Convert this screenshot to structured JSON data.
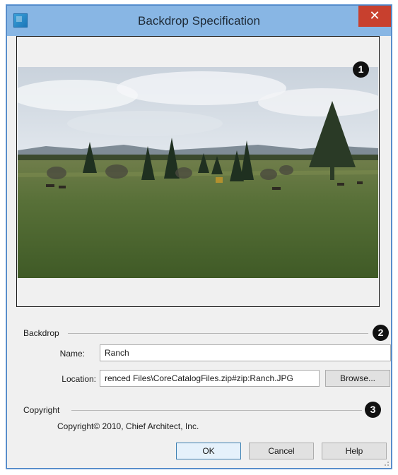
{
  "window": {
    "title": "Backdrop Specification",
    "close_glyph": "✕"
  },
  "icons": {
    "app": "app-icon",
    "close": "close-icon",
    "resize": "resize-grip-icon"
  },
  "callouts": [
    "1",
    "2",
    "3"
  ],
  "backdrop": {
    "group_label": "Backdrop",
    "name_label": "Name:",
    "name_value": "Ranch",
    "location_label": "Location:",
    "location_value": "renced Files\\CoreCatalogFiles.zip#zip:Ranch.JPG",
    "browse_label": "Browse..."
  },
  "copyright": {
    "group_label": "Copyright",
    "text": "Copyright© 2010, Chief Architect, Inc."
  },
  "buttons": {
    "ok": "OK",
    "cancel": "Cancel",
    "help": "Help"
  },
  "colors": {
    "titlebar": "#88b6e4",
    "close": "#c8402e",
    "dialog": "#f0f0f0"
  }
}
